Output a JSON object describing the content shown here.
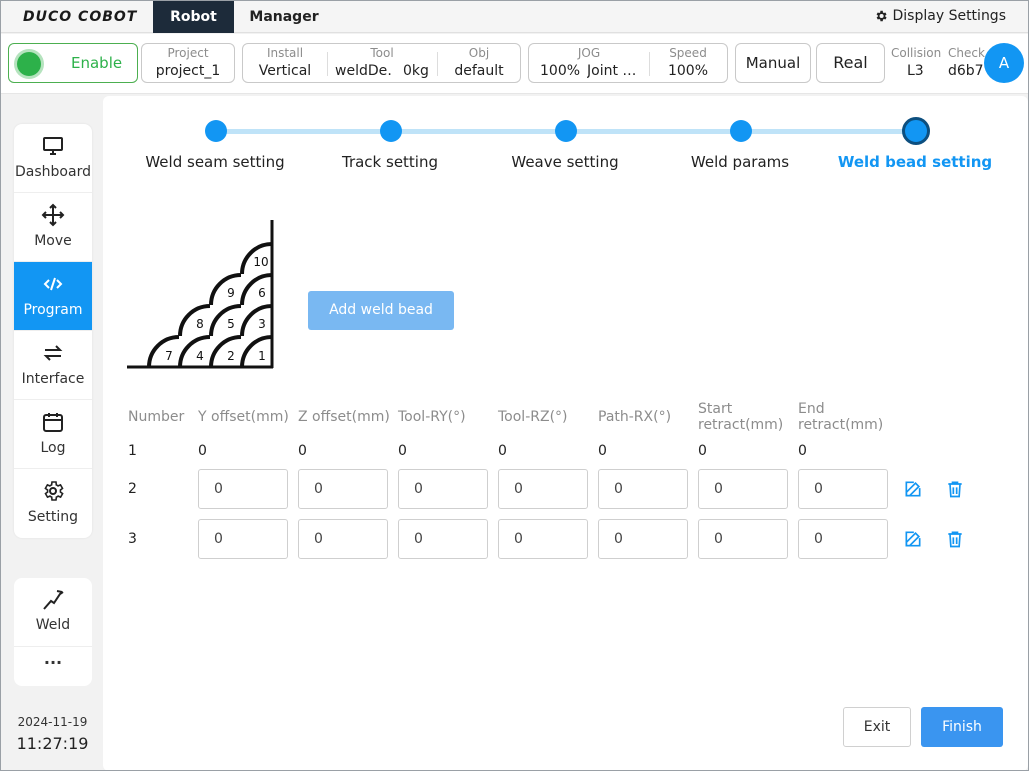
{
  "brand": {
    "logo": "DUCO COBOT"
  },
  "nav": {
    "tabs": [
      {
        "label": "Robot"
      },
      {
        "label": "Manager"
      }
    ],
    "display_settings": "Display Settings"
  },
  "status": {
    "enable": "Enable",
    "project": {
      "caption": "Project",
      "value": "project_1"
    },
    "install": {
      "caption": "Install",
      "value": "Vertical"
    },
    "tool": {
      "caption": "Tool",
      "name": "weldDe…",
      "mass": "0kg"
    },
    "obj": {
      "caption": "Obj",
      "value": "default"
    },
    "jog": {
      "caption": "JOG",
      "percent": "100%",
      "mode": "Joint …"
    },
    "speed": {
      "caption": "Speed",
      "value": "100%"
    },
    "manual": "Manual",
    "real": "Real",
    "collision": {
      "caption": "Collision",
      "value": "L3"
    },
    "check": {
      "caption": "Check",
      "value": "d6b7"
    },
    "avatar": "A"
  },
  "sidebar": {
    "items": [
      {
        "label": "Dashboard",
        "icon": "monitor-icon"
      },
      {
        "label": "Move",
        "icon": "move-icon"
      },
      {
        "label": "Program",
        "icon": "code-icon"
      },
      {
        "label": "Interface",
        "icon": "swap-icon"
      },
      {
        "label": "Log",
        "icon": "calendar-icon"
      },
      {
        "label": "Setting",
        "icon": "gear-icon"
      }
    ],
    "weld": "Weld",
    "more": "···"
  },
  "clock": {
    "date": "2024-11-19",
    "time": "11:27:19"
  },
  "steps": [
    {
      "label": "Weld seam setting"
    },
    {
      "label": "Track setting"
    },
    {
      "label": "Weave setting"
    },
    {
      "label": "Weld params"
    },
    {
      "label": "Weld bead setting"
    }
  ],
  "diagram": {
    "beads": [
      "1",
      "2",
      "3",
      "4",
      "5",
      "6",
      "7",
      "8",
      "9",
      "10"
    ]
  },
  "add_bead_button": "Add weld bead",
  "table": {
    "headers": [
      "Number",
      "Y offset(mm)",
      "Z offset(mm)",
      "Tool-RY(°)",
      "Tool-RZ(°)",
      "Path-RX(°)",
      "Start retract(mm)",
      "End retract(mm)"
    ],
    "header_lines": {
      "start": [
        "Start",
        "retract(mm)"
      ],
      "end": [
        "End",
        "retract(mm)"
      ]
    },
    "rows": [
      {
        "number": "1",
        "values": [
          "0",
          "0",
          "0",
          "0",
          "0",
          "0",
          "0"
        ]
      },
      {
        "number": "2",
        "values": [
          "0",
          "0",
          "0",
          "0",
          "0",
          "0",
          "0"
        ]
      },
      {
        "number": "3",
        "values": [
          "0",
          "0",
          "0",
          "0",
          "0",
          "0",
          "0"
        ]
      }
    ]
  },
  "footer": {
    "exit": "Exit",
    "finish": "Finish"
  },
  "colors": {
    "accent": "#1296f3",
    "nav_dark": "#1d2b3a",
    "enable_green": "#2db14a"
  }
}
